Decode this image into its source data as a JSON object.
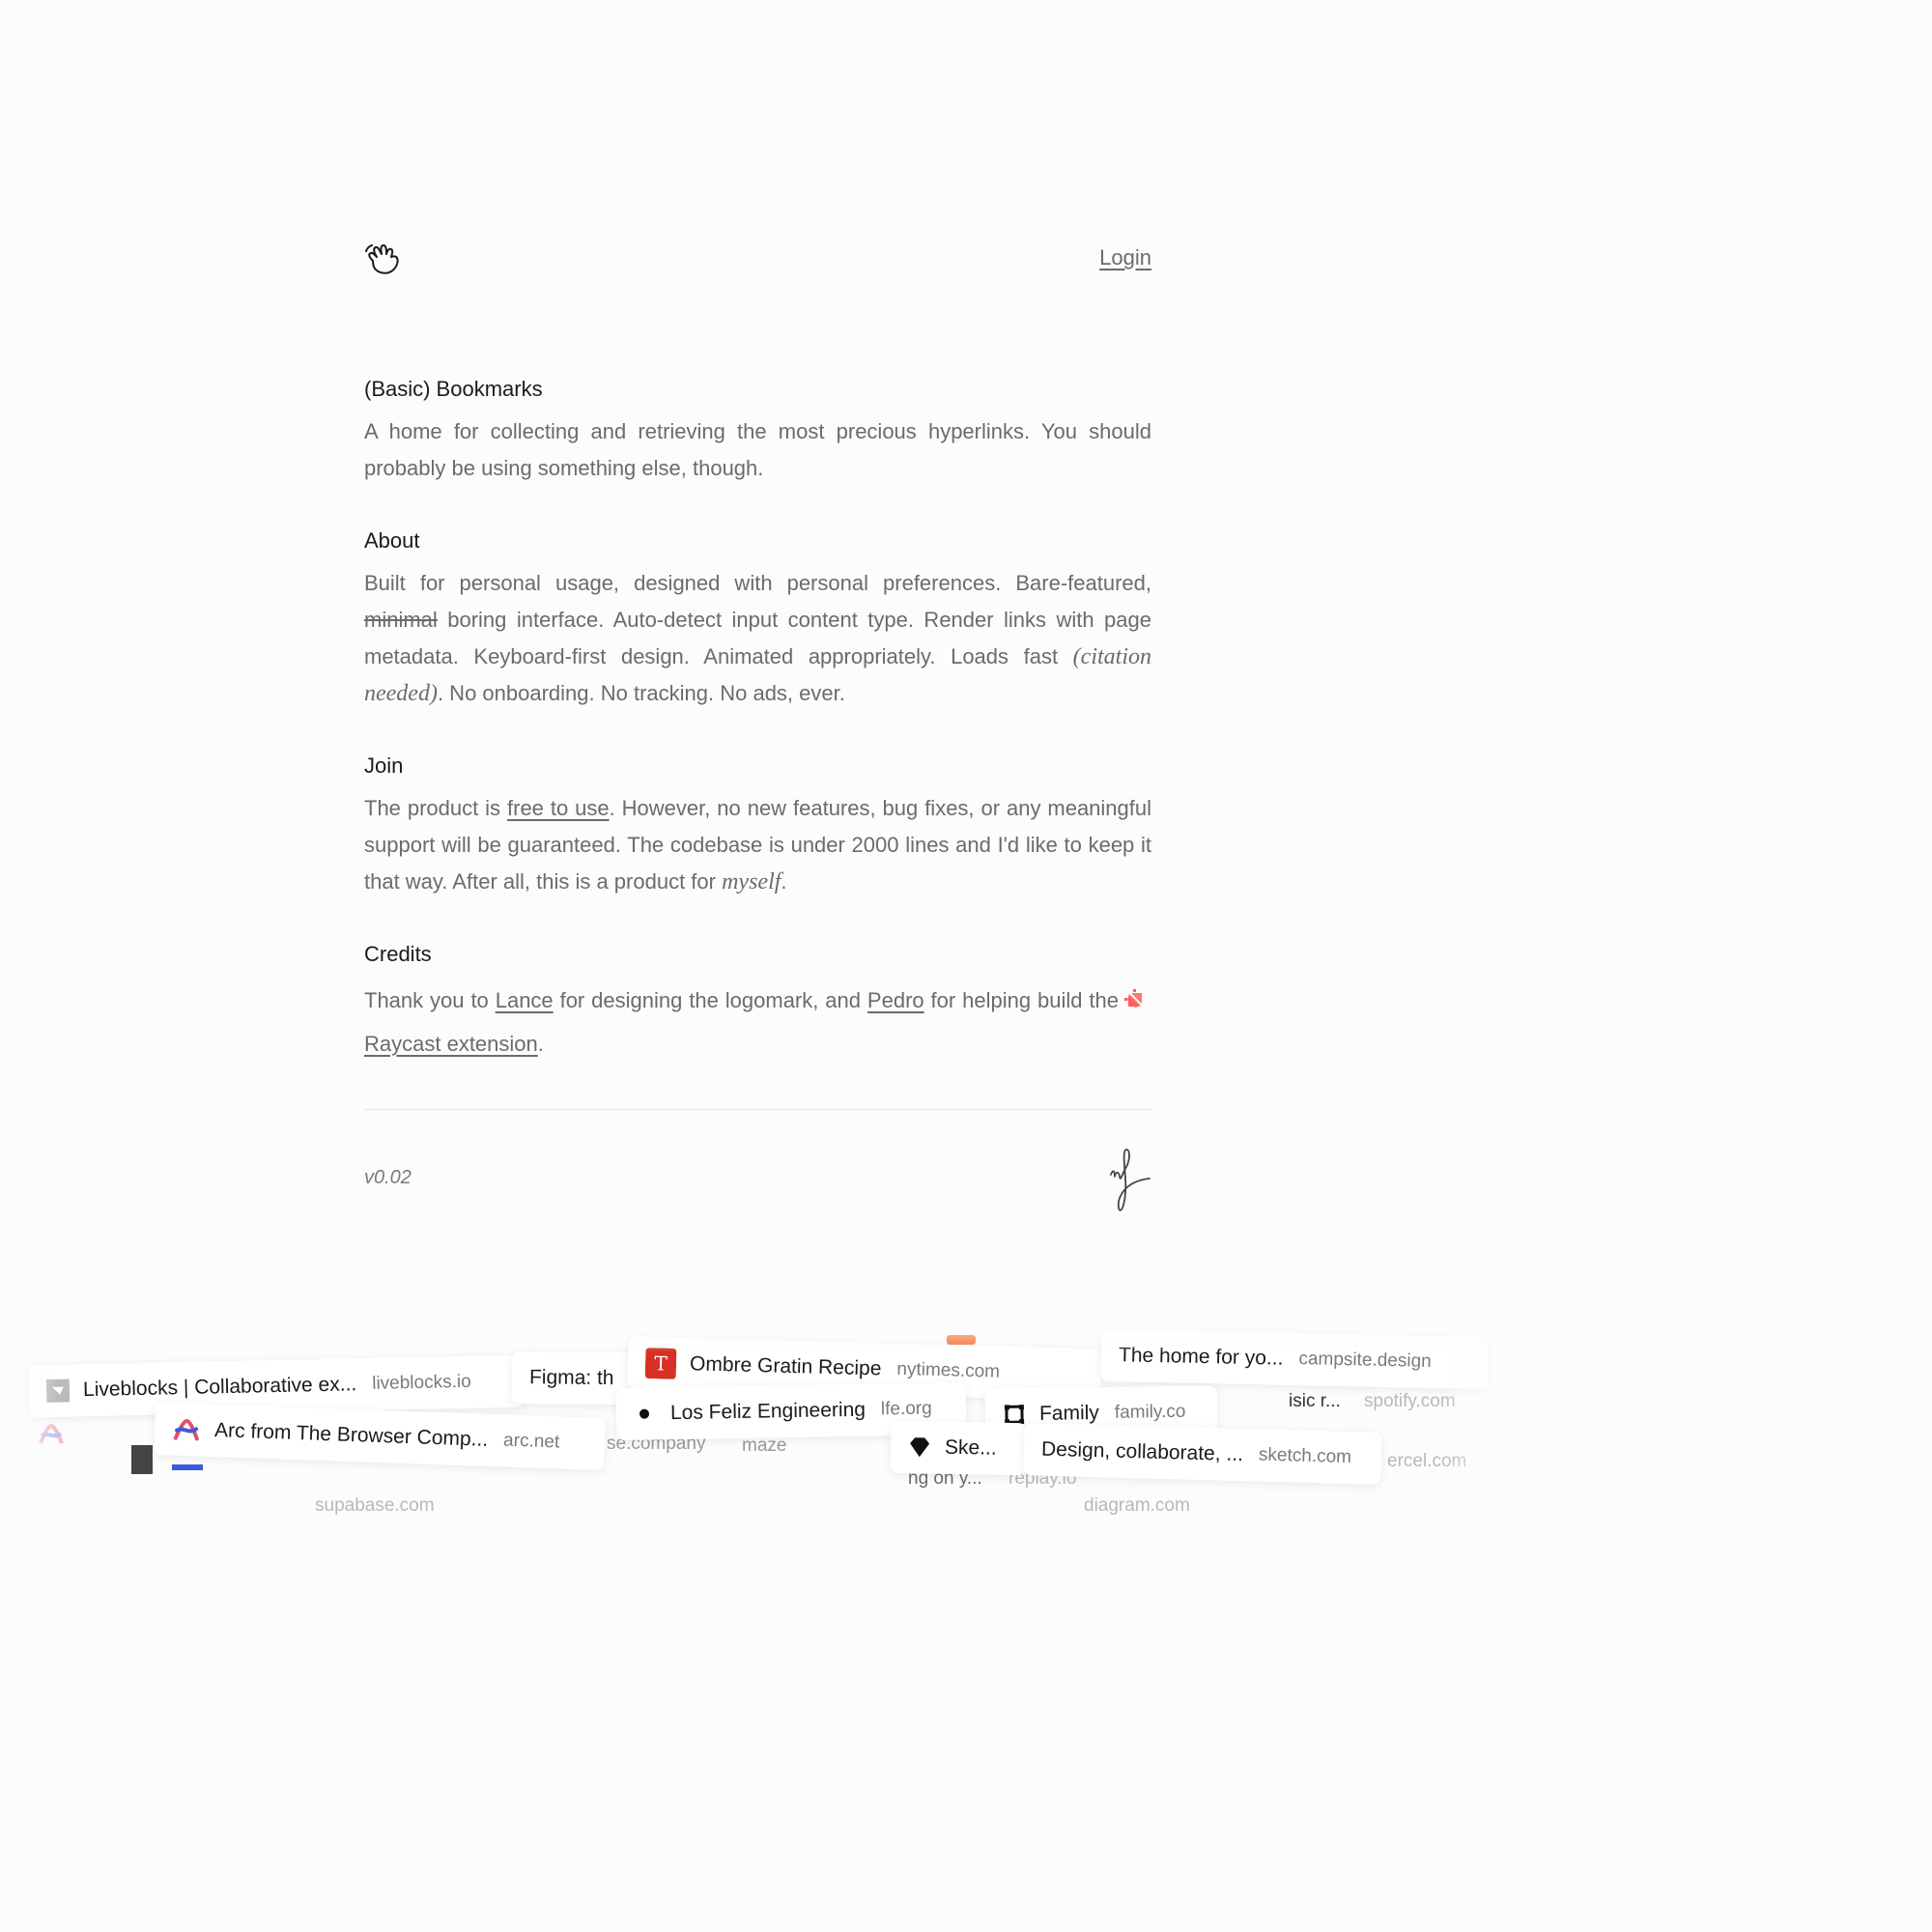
{
  "header": {
    "login_label": "Login"
  },
  "intro": {
    "title": "(Basic) Bookmarks",
    "body": "A home for collecting and retrieving the most precious hyperlinks. You should probably be using something else, though."
  },
  "about": {
    "title": "About",
    "part1": "Built for personal usage, designed with personal preferences. Bare-featured, ",
    "strike": "minimal",
    "part2": " boring interface. Auto-detect input content type. Render links with page metadata. Keyboard-first design. Animated appropriately. Loads fast ",
    "italic": "(citation needed)",
    "part3": ". No onboarding. No tracking. No ads, ever."
  },
  "join": {
    "title": "Join",
    "part1": "The product is ",
    "link": "free to use",
    "part2": ". However, no new features, bug fixes, or any meaningful support will be guaranteed. The codebase is under 2000 lines and I'd like to keep it that way. After all, this is a product for ",
    "italic": "myself",
    "part3": "."
  },
  "credits": {
    "title": "Credits",
    "part1": "Thank you to ",
    "link1": "Lance",
    "part2": " for designing the logomark, and ",
    "link2": "Pedro",
    "part3": " for helping build the",
    "link3": "Raycast extension",
    "part4": "."
  },
  "footer": {
    "version": "v0.02"
  },
  "bookmarks": [
    {
      "title": "Liveblocks | Collaborative ex...",
      "domain": "liveblocks.io"
    },
    {
      "title": "Figma: th",
      "domain": ""
    },
    {
      "title": "Ombre Gratin Recipe",
      "domain": "nytimes.com"
    },
    {
      "title": "The home for yo...",
      "domain": "campsite.design"
    },
    {
      "title": "Arc from The Browser Comp...",
      "domain": "arc.net"
    },
    {
      "title": "Los Feliz Engineering",
      "domain": "lfe.org"
    },
    {
      "title": "Family",
      "domain": "family.co"
    },
    {
      "title": "Ske...",
      "domain": ""
    },
    {
      "title": "Design, collaborate, ...",
      "domain": "sketch.com"
    }
  ],
  "ghost_text": [
    "spotify.com",
    "ercel.com",
    "supabase.com",
    "diagram.com",
    "ng on y...",
    "replay.io",
    "isic r...",
    "maze",
    "se.company"
  ],
  "colors": {
    "text": "#6b6b6b",
    "heading": "#1b1b1b",
    "nyt_red": "#d93025",
    "raycast_red": "#ff5f57"
  }
}
